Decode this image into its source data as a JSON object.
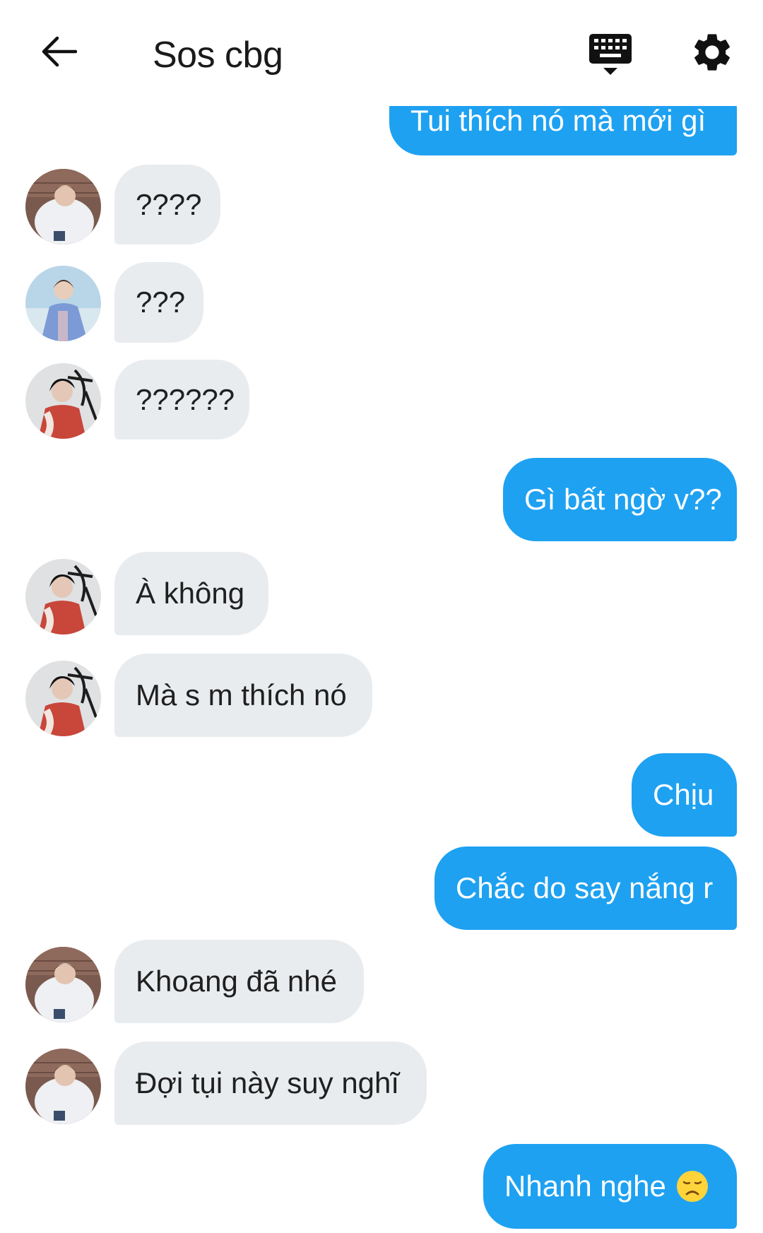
{
  "header": {
    "title": "Sos cbg",
    "back_icon": "arrow-left-icon",
    "keyboard_icon": "keyboard-icon",
    "settings_icon": "gear-icon"
  },
  "colors": {
    "outgoing_bubble": "#1ea1f1",
    "incoming_bubble": "#e9ecef"
  },
  "messages": [
    {
      "side": "out",
      "text": "Tui thích nó mà mới gì"
    },
    {
      "side": "in",
      "avatar": "avatar-a",
      "text": "????"
    },
    {
      "side": "in",
      "avatar": "avatar-b",
      "text": "???"
    },
    {
      "side": "in",
      "avatar": "avatar-c",
      "text": "??????"
    },
    {
      "side": "out",
      "text": "Gì bất ngờ v??"
    },
    {
      "side": "in",
      "avatar": "avatar-c",
      "text": "À không"
    },
    {
      "side": "in",
      "avatar": "avatar-c",
      "text": "Mà s m thích nó"
    },
    {
      "side": "out",
      "text": "Chịu"
    },
    {
      "side": "out",
      "text": "Chắc do say nắng r"
    },
    {
      "side": "in",
      "avatar": "avatar-a",
      "text": "Khoang đã nhé"
    },
    {
      "side": "in",
      "avatar": "avatar-a",
      "text": "Đợi tụi này suy nghĩ"
    },
    {
      "side": "out",
      "text": "Nhanh nghe",
      "emoji": "disappointed-face-icon"
    }
  ]
}
